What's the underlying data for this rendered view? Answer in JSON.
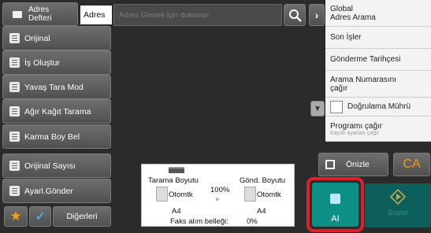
{
  "header": {
    "address_book_label": "Adres\nDefteri",
    "address_label": "Adres",
    "address_placeholder": "Adres Girmek için dokunun"
  },
  "sidebar": {
    "items": [
      {
        "label": "Orijinal",
        "icon": "original-icon"
      },
      {
        "label": "İş Oluştur",
        "icon": "job-build-icon"
      },
      {
        "label": "Yavaş Tara Mod",
        "icon": "slow-scan-icon"
      },
      {
        "label": "Ağır Kağıt Tarama",
        "icon": "heavy-paper-icon"
      },
      {
        "label": "Karma Boy Bel",
        "icon": "mixed-size-icon"
      },
      {
        "label": "Orijinal Sayısı",
        "icon": "original-count-icon"
      },
      {
        "label": "Ayarl.Gönder",
        "icon": "send-settings-icon"
      }
    ],
    "others_label": "Diğerleri"
  },
  "right_panel": {
    "global_search": "Global\nAdres Arama",
    "recent_jobs": "Son İşler",
    "send_history": "Gönderme Tarihçesi",
    "call_search_number": "Arama Numarasını\nçağır",
    "verify_stamp": "Doğrulama Mührü",
    "call_program": "Programı çağır",
    "call_program_sub": "Kayıtlı ayarları çağır"
  },
  "preview": {
    "label": "Önizle",
    "ca_label": "CA"
  },
  "status": {
    "scan_size_label": "Tarama Boyutu",
    "send_size_label": "Gönd. Boyutu",
    "scan_auto": "Otomtk",
    "send_auto": "Otomtk",
    "ratio": "100%",
    "scan_paper": "A4",
    "send_paper": "A4",
    "fax_memory_label": "Faks alım belleği:",
    "fax_memory_value": "0%"
  },
  "ai_button": {
    "label": "AI"
  },
  "start_button": {
    "label": "Başlat"
  },
  "colors": {
    "accent_green": "#0e8f86",
    "highlight_red": "#e01f2b",
    "ca_orange": "#f29c14"
  }
}
